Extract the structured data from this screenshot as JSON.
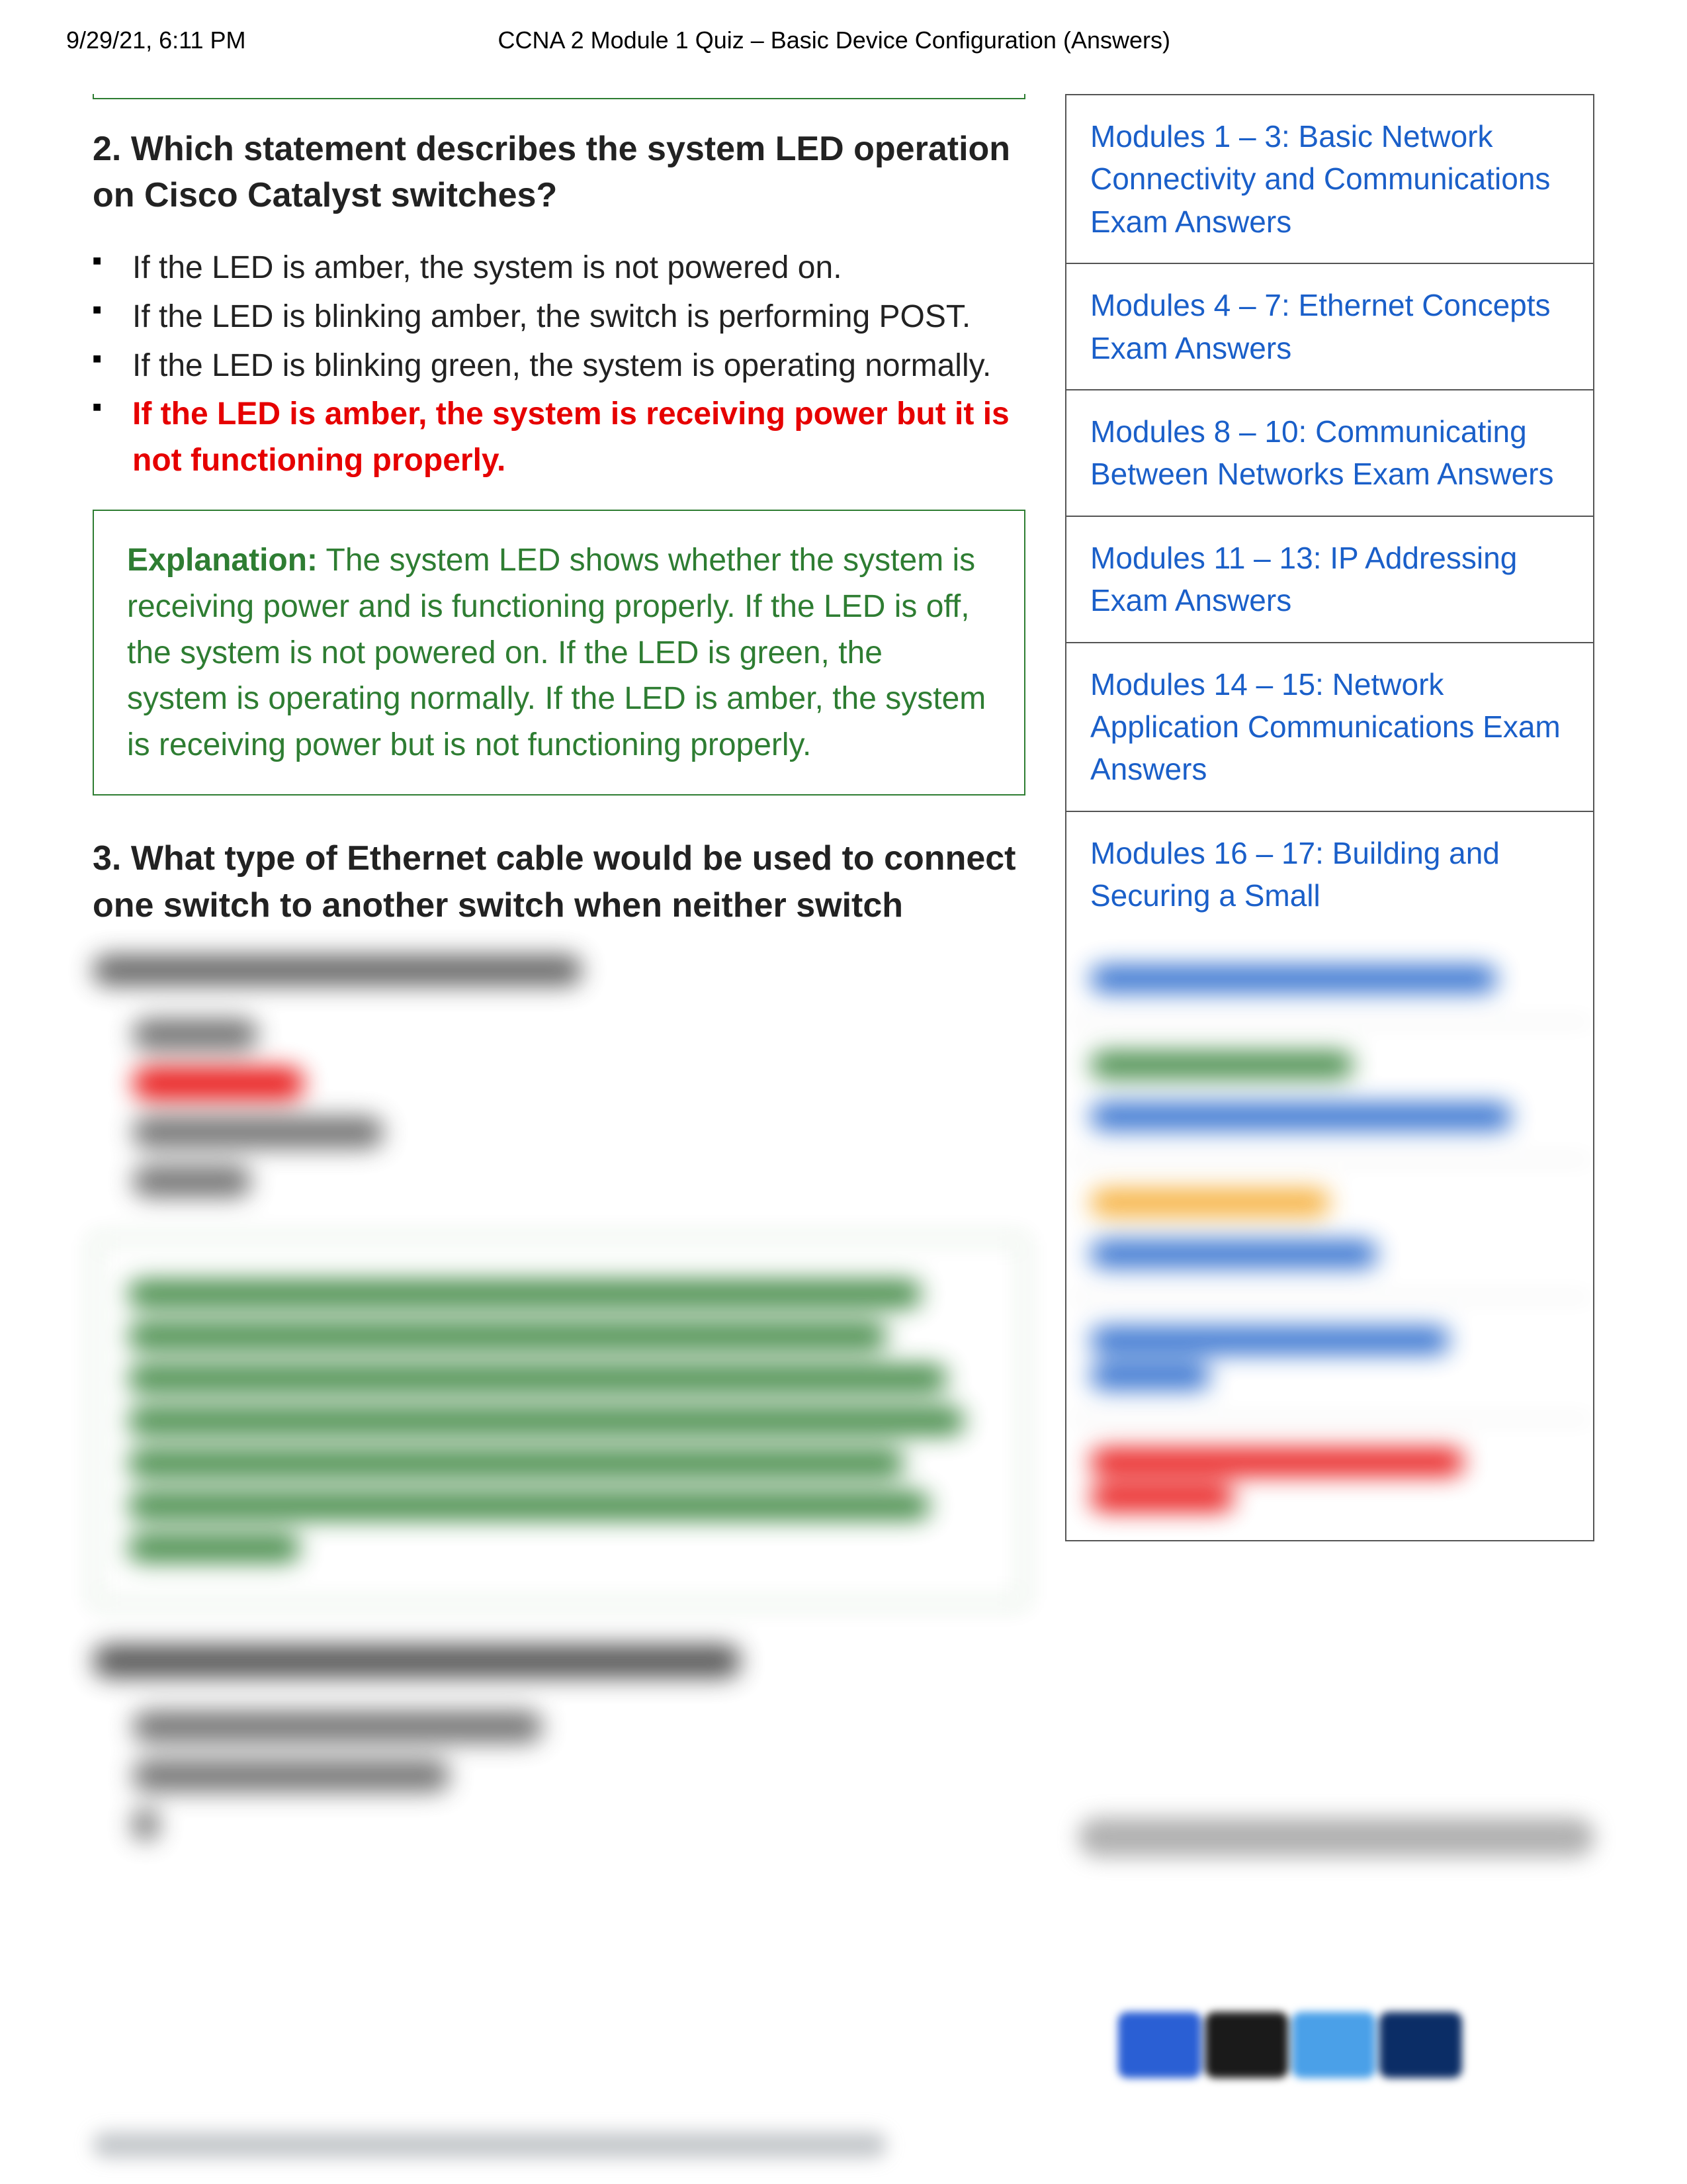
{
  "header": {
    "timestamp": "9/29/21, 6:11 PM",
    "title": "CCNA 2 Module 1 Quiz – Basic Device Configuration (Answers)"
  },
  "q2": {
    "title": "2. Which statement describes the system LED operation on Cisco Catalyst switches?",
    "opts": [
      "If the LED is amber, the system is not powered on.",
      "If the LED is blinking amber, the switch is performing POST.",
      "If the LED is blinking green, the system is operating normally.",
      "If the LED is amber, the system is receiving power but it is not functioning properly."
    ],
    "correct_index": 3,
    "exp_label": "Explanation:",
    "exp_body": " The system LED shows whether the system is receiving power and is functioning properly. If the LED is off, the system is not powered on. If the LED is green, the system is operating normally. If the LED is amber, the system is receiving power but is not functioning properly."
  },
  "q3": {
    "title": "3. What type of Ethernet cable would be used to connect one switch to another switch when neither switch"
  },
  "sidebar": {
    "items": [
      "Modules 1 – 3: Basic Network Connectivity and Communications Exam Answers",
      "Modules 4 – 7: Ethernet Concepts Exam Answers",
      "Modules 8 – 10: Communicating Between Networks Exam Answers",
      "Modules 11 – 13: IP Addressing Exam Answers",
      "Modules 14 – 15: Network Application Communications Exam Answers",
      "Modules 16 – 17: Building and Securing a Small"
    ]
  }
}
